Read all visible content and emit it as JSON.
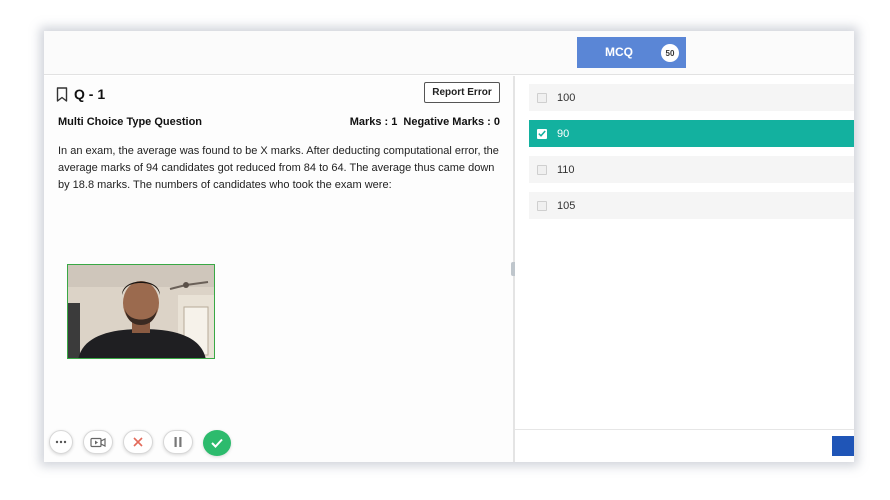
{
  "header": {
    "tab_label": "MCQ",
    "tab_count": "50",
    "tab_color": "#5a86d6"
  },
  "question": {
    "number": "Q - 1",
    "report_label": "Report Error",
    "type_label": "Multi Choice Type Question",
    "marks_label": "Marks : 1",
    "negative_marks_label": "Negative Marks : 0",
    "text": "In an exam, the average was found to be X marks. After deducting computational error, the average marks of 94 candidates got reduced from 84 to 64. The average thus came down by 18.8 marks. The numbers of candidates who took the exam were:"
  },
  "options": [
    {
      "label": "100",
      "selected": false
    },
    {
      "label": "90",
      "selected": true
    },
    {
      "label": "110",
      "selected": false
    },
    {
      "label": "105",
      "selected": false
    }
  ],
  "proctor_toolbar": {
    "icons": [
      "more-icon",
      "camera-icon",
      "close-icon",
      "pause-icon",
      "check-icon"
    ]
  },
  "colors": {
    "selected_option": "#13b19f",
    "submit_button": "#1f55b7",
    "confirm_button": "#2dbb6d"
  }
}
